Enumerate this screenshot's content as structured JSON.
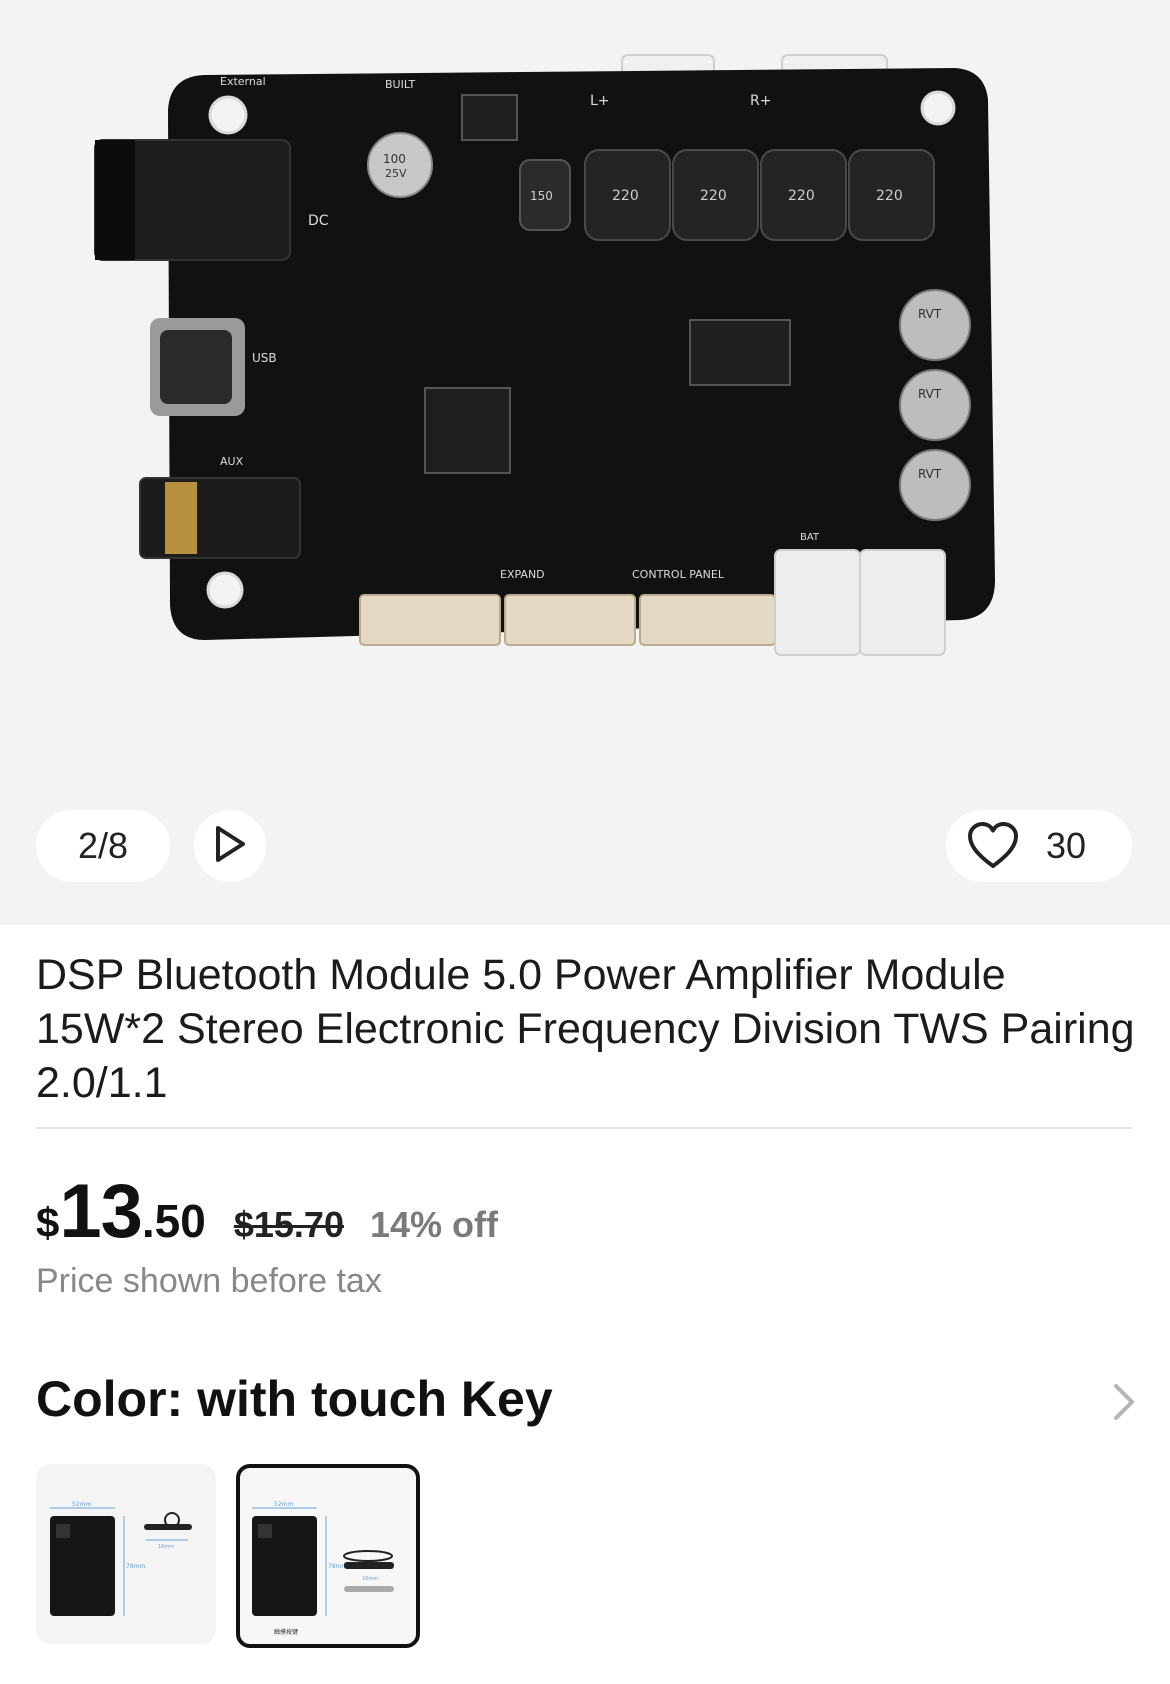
{
  "gallery": {
    "counter": "2/8",
    "favorites_count": "30",
    "board_labels": {
      "external": "External",
      "built": "BUILT",
      "dc": "DC",
      "usb": "USB",
      "aux": "AUX",
      "expand": "EXPAND",
      "control_panel": "CONTROL PANEL",
      "bat": "BAT",
      "cap_value": "100",
      "cap_voltage": "25V",
      "cap_brand": "RVT",
      "inductor_value": "220",
      "inductor_small": "150",
      "left_plus": "L+",
      "right_plus": "R+"
    }
  },
  "product": {
    "title": "DSP Bluetooth Module 5.0 Power Amplifier Module 15W*2 Stereo Electronic Frequency Division TWS Pairing 2.0/1.1",
    "price": {
      "currency": "$",
      "whole": "13",
      "fraction": ".50"
    },
    "original_price": "$15.70",
    "discount": "14% off",
    "tax_note": "Price shown before tax"
  },
  "variant": {
    "heading": "Color: with touch Key",
    "options": [
      {
        "dim_width": "52mm",
        "dim_height": "78mm",
        "dim_small": "16mm"
      },
      {
        "dim_width": "52mm",
        "dim_height": "78mm",
        "dim_small": "16mm",
        "caption": "触摸按键"
      }
    ]
  },
  "colors": {
    "board": "#111111",
    "background": "#f3f3f3",
    "text": "#1b1b1b",
    "muted": "#888888",
    "selected_border": "#111111"
  }
}
